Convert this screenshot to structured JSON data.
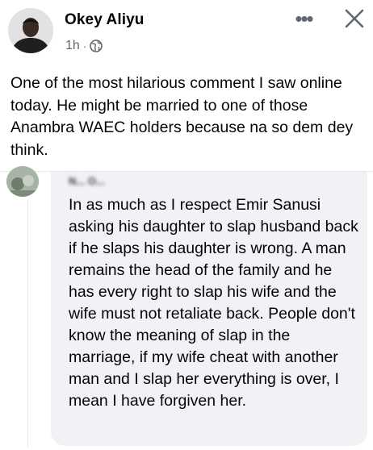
{
  "post": {
    "author": "Okey Aliyu",
    "time": "1h",
    "separator": "·",
    "privacy_icon": "globe-icon",
    "more_icon": "more-dots-icon",
    "more_label": "•••",
    "close_icon": "close-icon",
    "text": "One of the most hilarious comment I saw online today. He might be married to one of those Anambra WAEC holders because na so dem dey think."
  },
  "comment": {
    "author_obscured": "N... O...",
    "text": "In as much as I respect Emir Sanusi asking his daughter to slap husband back if he slaps his daughter is wrong. A man remains the head of the family and he has every right to slap his wife and the wife must not retaliate back. People don't know the meaning of slap in the marriage, if my wife cheat with another man and I slap her everything is over, I mean I have forgiven her."
  },
  "colors": {
    "background": "#ffffff",
    "text": "#050505",
    "secondary_text": "#65676b",
    "bubble": "#f0f2f5"
  }
}
